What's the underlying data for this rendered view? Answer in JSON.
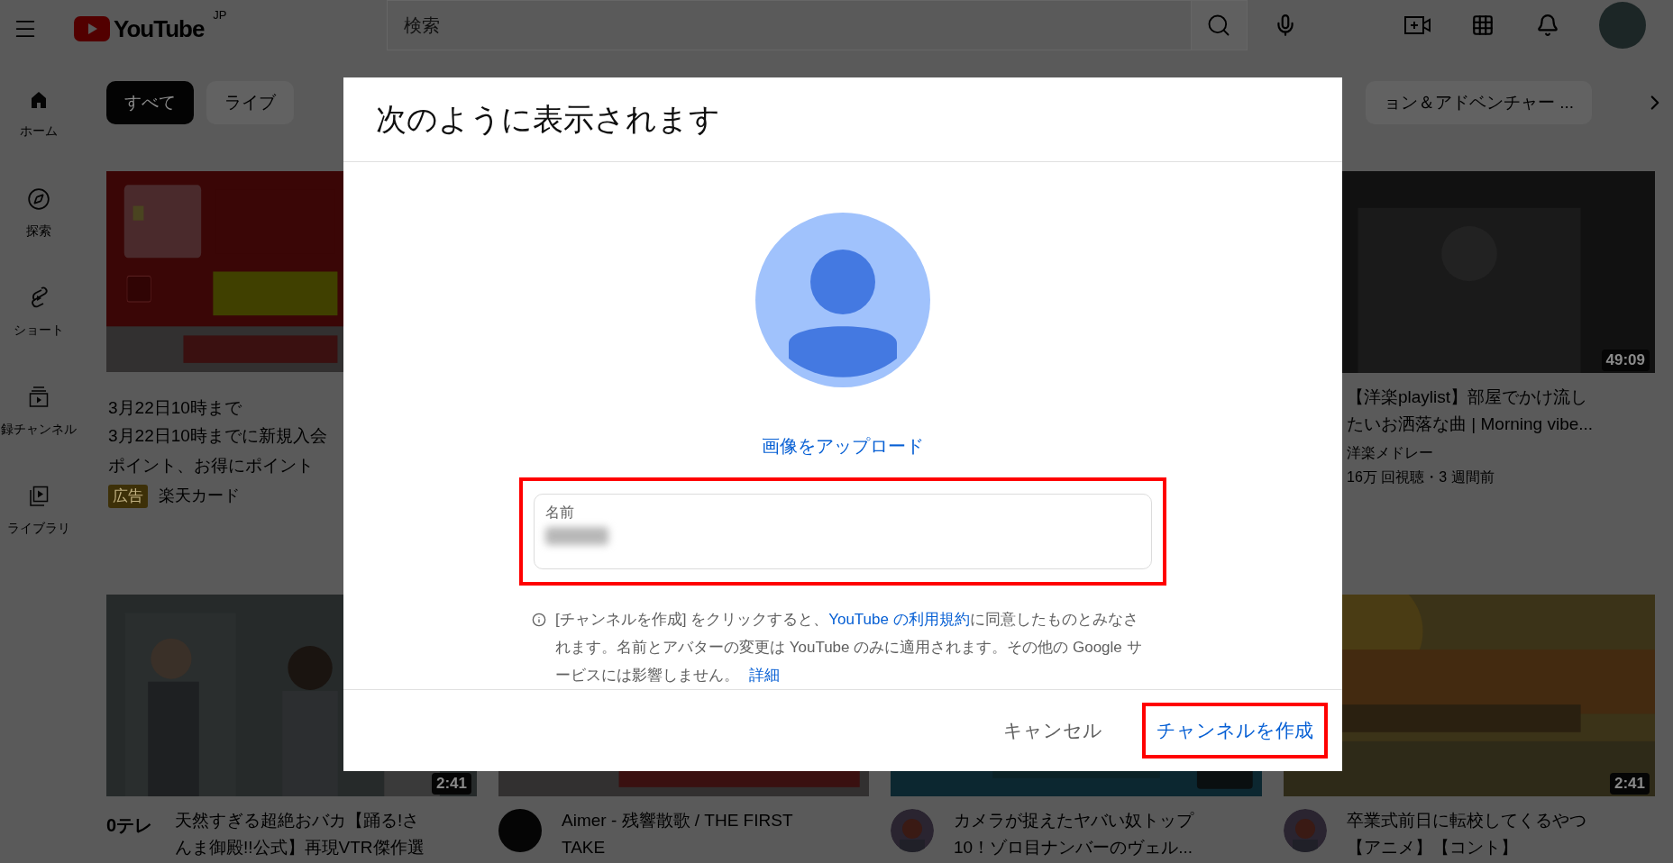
{
  "top_bar": {
    "logo_text": "YouTube",
    "region": "JP",
    "search": {
      "placeholder": "検索"
    }
  },
  "sidebar": {
    "items": [
      {
        "kind": "home",
        "label": "ホーム"
      },
      {
        "kind": "explore",
        "label": "探索"
      },
      {
        "kind": "shorts",
        "label": "ショート"
      },
      {
        "kind": "subscriptions",
        "label": "録チャンネル"
      },
      {
        "kind": "library",
        "label": "ライブラリ"
      }
    ]
  },
  "chips": [
    {
      "label": "すべて",
      "selected": true
    },
    {
      "label": "ライブ",
      "selected": false
    },
    {
      "label": "ョン＆アドベンチャー ...",
      "selected": false
    }
  ],
  "videos": [
    {
      "kind": "ad",
      "title": "3月22日10時まで",
      "description_lines": [
        "3月22日10時までに新規入会",
        "ポイント、お得にポイント"
      ],
      "badge": "広告",
      "advertiser": "楽天カード"
    },
    {
      "kind": "hidden"
    },
    {
      "kind": "hidden"
    },
    {
      "kind": "video",
      "duration": "49:09",
      "title_lines": [
        "【洋楽playlist】部屋でかけ流し",
        "たいお洒落な曲 | Morning vibe..."
      ],
      "channel": "洋楽メドレー",
      "stats": "16万 回視聴・3 週間前"
    },
    {
      "kind": "video",
      "avatar": {
        "kind": "text",
        "text": "0テレ"
      },
      "duration": "2:41",
      "title_lines": [
        "天然すぎる超絶おバカ【踊る!さ",
        "んま御殿!!公式】再現VTR傑作選"
      ]
    },
    {
      "kind": "video",
      "avatar": {
        "kind": "logo"
      },
      "title_lines": [
        "Aimer - 残響散歌 / THE FIRST",
        "TAKE"
      ]
    },
    {
      "kind": "video",
      "avatar": {
        "kind": "picture"
      },
      "title_lines": [
        "カメラが捉えたヤバい奴トップ",
        "10！ゾロ目ナンバーのヴェル..."
      ]
    },
    {
      "kind": "video",
      "avatar": {
        "kind": "picture"
      },
      "duration": "2:41",
      "title_lines": [
        "卒業式前日に転校してくるやつ",
        "【アニメ】【コント】"
      ]
    }
  ],
  "dialog": {
    "title": "次のように表示されます",
    "upload_link": "画像をアップロード",
    "name_field": {
      "label": "名前",
      "highlighted": true
    },
    "info": {
      "before": "[チャンネルを作成] をクリックすると、",
      "terms_link": "YouTube の利用規約",
      "after": "に同意したものとみなされます。名前とアバターの変更は YouTube のみに適用されます。その他の Google サービスには影響しません。",
      "details_link": "詳細"
    },
    "buttons": [
      {
        "label": "キャンセル",
        "kind": "cancel",
        "highlighted": false
      },
      {
        "label": "チャンネルを作成",
        "kind": "primary",
        "highlighted": true
      }
    ]
  }
}
